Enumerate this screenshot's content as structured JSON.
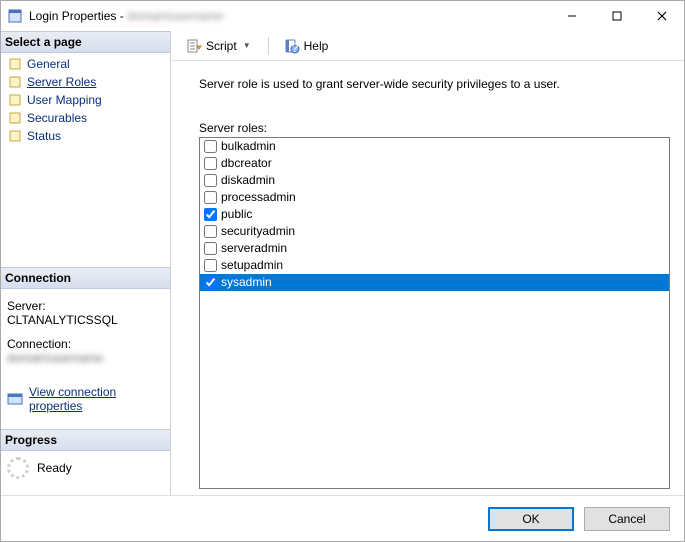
{
  "window": {
    "title_prefix": "Login Properties - ",
    "title_user": "domain\\username"
  },
  "sidebar": {
    "select_page_header": "Select a page",
    "pages": [
      {
        "label": "General"
      },
      {
        "label": "Server Roles"
      },
      {
        "label": "User Mapping"
      },
      {
        "label": "Securables"
      },
      {
        "label": "Status"
      }
    ],
    "connection_header": "Connection",
    "connection": {
      "server_label": "Server:",
      "server_value": "CLTANALYTICSSQL",
      "connection_label": "Connection:",
      "connection_value": "domain\\username",
      "view_props_link": "View connection properties"
    },
    "progress_header": "Progress",
    "progress_status": "Ready"
  },
  "toolbar": {
    "script_label": "Script",
    "help_label": "Help"
  },
  "main": {
    "description": "Server role is used to grant server-wide security privileges to a user.",
    "roles_label": "Server roles:",
    "roles": [
      {
        "name": "bulkadmin",
        "checked": false,
        "selected": false
      },
      {
        "name": "dbcreator",
        "checked": false,
        "selected": false
      },
      {
        "name": "diskadmin",
        "checked": false,
        "selected": false
      },
      {
        "name": "processadmin",
        "checked": false,
        "selected": false
      },
      {
        "name": "public",
        "checked": true,
        "selected": false
      },
      {
        "name": "securityadmin",
        "checked": false,
        "selected": false
      },
      {
        "name": "serveradmin",
        "checked": false,
        "selected": false
      },
      {
        "name": "setupadmin",
        "checked": false,
        "selected": false
      },
      {
        "name": "sysadmin",
        "checked": true,
        "selected": true
      }
    ]
  },
  "footer": {
    "ok_label": "OK",
    "cancel_label": "Cancel"
  }
}
